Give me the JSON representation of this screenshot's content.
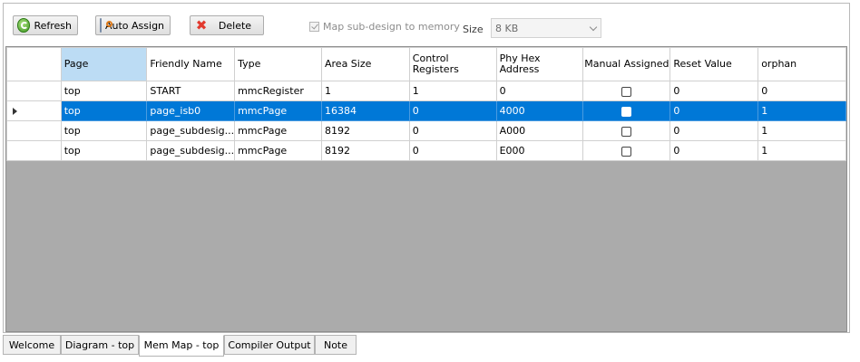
{
  "toolbar": {
    "refresh_label": "Refresh",
    "auto_assign_label": "Auto Assign",
    "delete_label": "Delete",
    "map_checkbox_label": "Map sub-design to memory",
    "map_checkbox_checked": true,
    "size_label": "Size",
    "size_value": "8 KB"
  },
  "table": {
    "columns": [
      "Page",
      "Friendly Name",
      "Type",
      "Area Size",
      "Control Registers",
      "Phy Hex Address",
      "Manual Assigned",
      "Reset Value",
      "orphan"
    ],
    "rows": [
      {
        "page": "top",
        "friendly": "START",
        "type": "mmcRegister",
        "area": "1",
        "control": "1",
        "phy": "0",
        "manual": false,
        "reset": "0",
        "orphan": "0"
      },
      {
        "page": "top",
        "friendly": "page_isb0",
        "type": "mmcPage",
        "area": "16384",
        "control": "0",
        "phy": "4000",
        "manual": false,
        "reset": "0",
        "orphan": "1"
      },
      {
        "page": "top",
        "friendly": "page_subdesig...",
        "type": "mmcPage",
        "area": "8192",
        "control": "0",
        "phy": "A000",
        "manual": false,
        "reset": "0",
        "orphan": "1"
      },
      {
        "page": "top",
        "friendly": "page_subdesig...",
        "type": "mmcPage",
        "area": "8192",
        "control": "0",
        "phy": "E000",
        "manual": false,
        "reset": "0",
        "orphan": "1"
      }
    ],
    "selected_row": 1
  },
  "tabs": [
    {
      "label": "Welcome",
      "active": false
    },
    {
      "label": "Diagram - top",
      "active": false
    },
    {
      "label": "Mem Map - top",
      "active": true
    },
    {
      "label": "Compiler Output",
      "active": false
    },
    {
      "label": "Note",
      "active": false
    }
  ],
  "icons": {
    "refresh": "refresh-icon",
    "auto_assign": "auto-assign-icon",
    "delete": "delete-x-icon"
  },
  "colors": {
    "selection": "#0078d7",
    "header_selected": "#bcdcf4",
    "empty_area": "#ababab"
  }
}
